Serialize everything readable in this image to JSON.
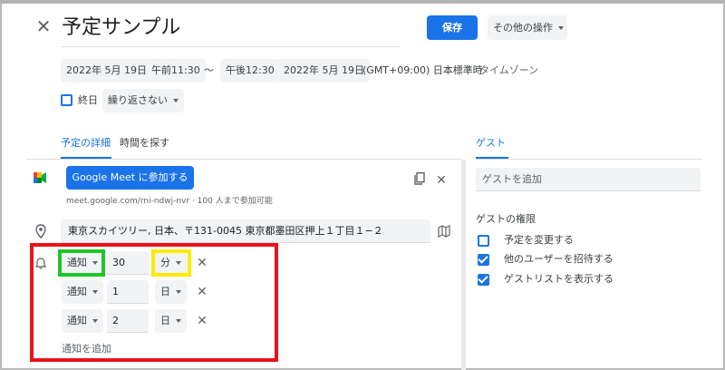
{
  "header": {
    "close_icon": "close-icon",
    "title": "予定サンプル",
    "save_label": "保存",
    "more_actions_label": "その他の操作"
  },
  "datetime": {
    "start_date": "2022年 5月 19日",
    "start_time": "午前11:30",
    "separator": "〜",
    "end_time": "午後12:30",
    "end_date": "2022年 5月 19日",
    "timezone_value": "(GMT+09:00) 日本標準時",
    "timezone_label": "タイムゾーン"
  },
  "options": {
    "all_day_label": "終日",
    "all_day_checked": false,
    "repeat_label": "繰り返さない"
  },
  "tabs": [
    {
      "label": "予定の詳細",
      "active": true
    },
    {
      "label": "時間を探す",
      "active": false
    }
  ],
  "meet": {
    "icon": "google-meet-icon",
    "button_label": "Google Meet に参加する",
    "url_text": "meet.google.com/rni-ndwj-nvr · 100 人まで参加可能",
    "copy_icon": "copy-icon",
    "remove_icon": "close-icon"
  },
  "location": {
    "icon": "location-pin-icon",
    "value": "東京スカイツリー, 日本、〒131-0045 東京都墨田区押上１丁目１−２",
    "map_icon": "map-icon"
  },
  "notifications": {
    "icon": "bell-icon",
    "rows": [
      {
        "type": "通知",
        "value": "30",
        "unit": "分"
      },
      {
        "type": "通知",
        "value": "1",
        "unit": "日"
      },
      {
        "type": "通知",
        "value": "2",
        "unit": "日"
      }
    ],
    "add_label": "通知を追加"
  },
  "guests": {
    "tab_label": "ゲスト",
    "add_placeholder": "ゲストを追加",
    "permissions_title": "ゲストの権限",
    "permissions": [
      {
        "label": "予定を変更する",
        "checked": false
      },
      {
        "label": "他のユーザーを招待する",
        "checked": true
      },
      {
        "label": "ゲストリストを表示する",
        "checked": true
      }
    ]
  },
  "colors": {
    "accent": "#1a73e8",
    "highlight_red": "#e8141a",
    "highlight_green": "#1dc72a",
    "highlight_yellow": "#ffea00"
  }
}
